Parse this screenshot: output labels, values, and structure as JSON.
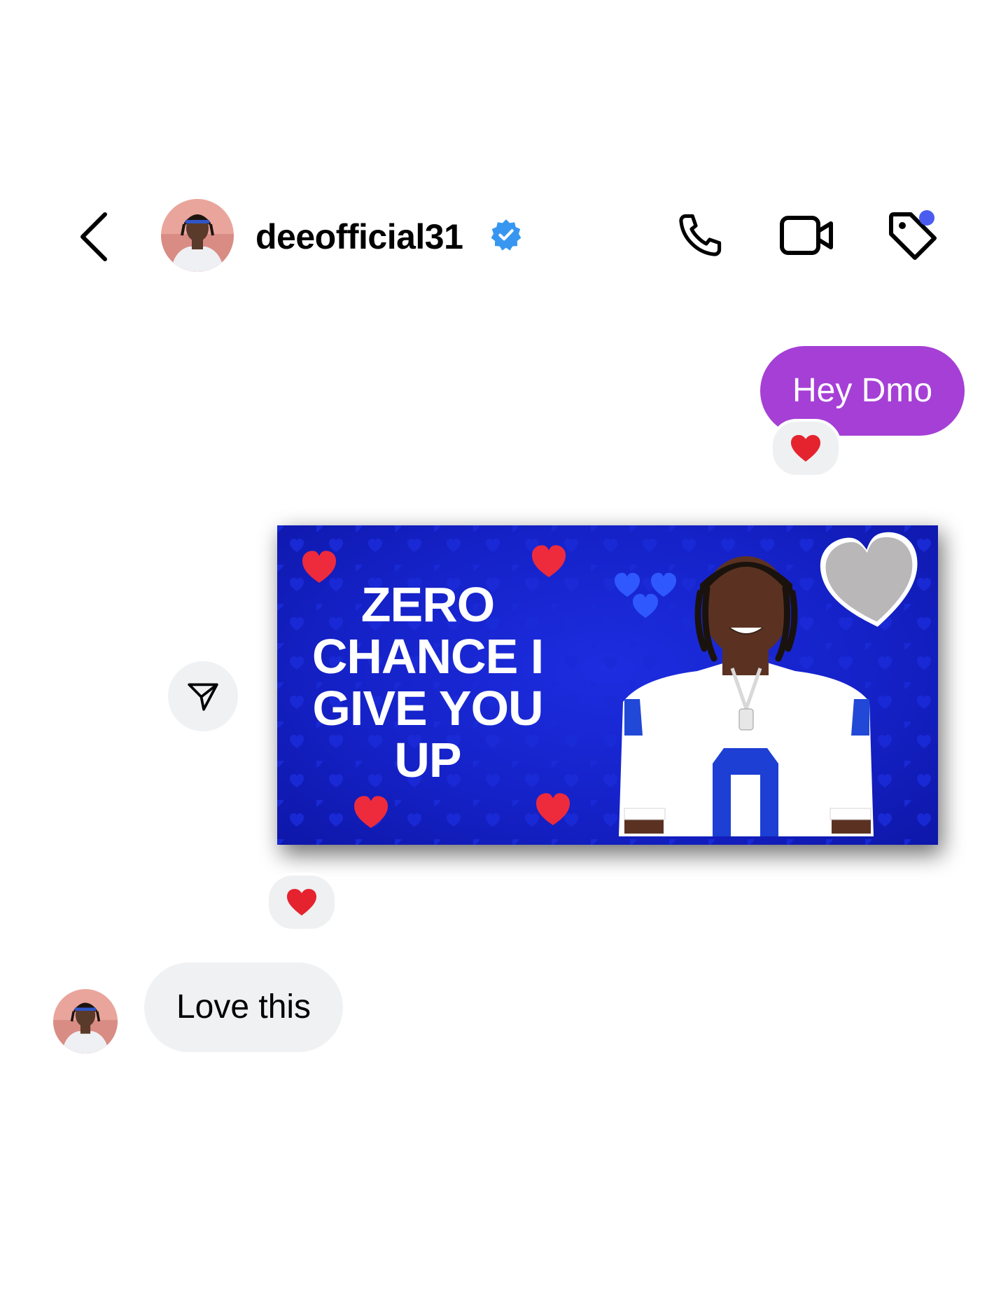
{
  "header": {
    "username": "deeofficial31",
    "verified": true,
    "icons": [
      "back-chevron-icon",
      "phone-icon",
      "video-camera-icon",
      "tag-icon"
    ],
    "notification_dot_color": "#4a5cf0"
  },
  "messages": [
    {
      "direction": "outgoing",
      "type": "text",
      "text": "Hey Dmo",
      "bubble_color": "#a53fd6",
      "reaction": "❤️"
    },
    {
      "direction": "outgoing",
      "type": "image",
      "headline": "ZERO CHANCE I GIVE YOU UP",
      "image_background": "#1522c8",
      "reaction": "❤️"
    },
    {
      "direction": "incoming",
      "type": "text",
      "text": "Love this",
      "bubble_color": "#eff1f3"
    }
  ]
}
